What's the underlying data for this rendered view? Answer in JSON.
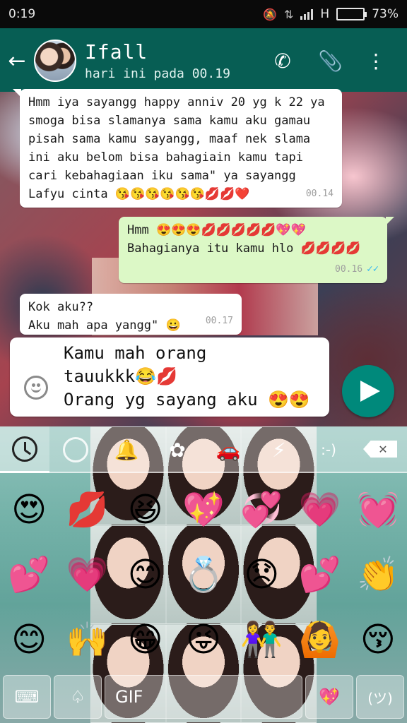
{
  "statusbar": {
    "time": "0:19",
    "network_type": "H",
    "battery": "73%",
    "battery_level": 0.73,
    "icons": [
      "mute-icon",
      "data-icon",
      "signal-icon",
      "battery-icon"
    ]
  },
  "header": {
    "contact_name": "Ifall",
    "last_seen": "hari ini pada 00.19",
    "icons": [
      "back-arrow-icon",
      "phone-icon",
      "attach-icon",
      "more-icon"
    ]
  },
  "messages": [
    {
      "direction": "in",
      "text": "Hmm iya sayangg happy anniv 20 yg k 22 ya\nsmoga bisa slamanya sama kamu aku gamau\npisah sama kamu sayangg, maaf nek slama\nini aku belom bisa bahagiain kamu tapi\ncari kebahagiaan iku sama\" ya sayangg\nLafyu cinta 😘😘😘😘😘😘💋💋❤️",
      "time": "00.14"
    },
    {
      "direction": "out",
      "text": "Hmm 😍😍😍💋💋💋💋💋💖💖\nBahagianya itu kamu hlo 💋💋💋💋",
      "time": "00.16",
      "ticks": "✓✓"
    },
    {
      "direction": "in",
      "text": "Kok aku??\nAku mah apa yangg\" 😀",
      "time": "00.17"
    }
  ],
  "compose": {
    "text": "Kamu mah orang\ntauukkk😂💋\nOrang yg sayang aku 😍😍"
  },
  "keyboard": {
    "tabs": [
      "recent",
      "smileys",
      "objects",
      "nature",
      "food",
      "travel",
      "symbols",
      ":-)"
    ],
    "emoticon_tab": ":-)",
    "emojis": [
      "😍",
      "💋",
      "😆",
      "💖",
      "💞",
      "💗",
      "💓",
      "💕",
      "💗",
      "😊",
      "💍",
      "😞",
      "💕",
      "👏",
      "😊",
      "🙌",
      "😁",
      "😜",
      "👫",
      "🙆",
      "😚"
    ],
    "bottom_keys": {
      "gif": "GIF",
      "emoticon": "(ツ)"
    },
    "accent_colors": {
      "appbar": "#075e54",
      "send": "#00897b",
      "outgoing_bubble": "#dcf8c6"
    }
  }
}
